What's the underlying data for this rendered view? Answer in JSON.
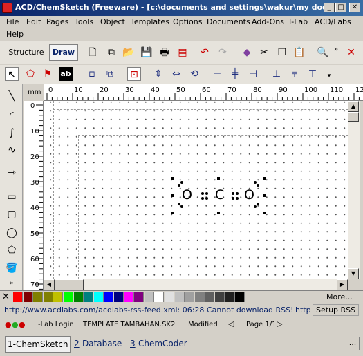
{
  "window": {
    "title": "ACD/ChemSketch (Freeware) - [c:\\documents and settings\\wakur\\my docu...",
    "min_glyph": "_",
    "max_glyph": "□",
    "close_glyph": "✕"
  },
  "menu": {
    "row1": [
      "File",
      "Edit",
      "Pages",
      "Tools",
      "Object",
      "Templates",
      "Options",
      "Documents",
      "Add-Ons",
      "I-Lab",
      "ACD/Labs"
    ],
    "row2": [
      "Help"
    ]
  },
  "modes": {
    "structure": "Structure",
    "draw": "Draw",
    "active": "Draw"
  },
  "toolbar1_icons": [
    "new-page-icon",
    "copy-page-icon",
    "open-folder-icon",
    "save-icon",
    "print-icon",
    "pdf-icon",
    "undo-icon",
    "redo-icon",
    "eraser-icon",
    "cut-icon",
    "copy-icon",
    "paste-icon",
    "zoom-icon"
  ],
  "toolbar2_icons": [
    "select-arrow-icon",
    "lasso-icon",
    "hand-icon",
    "text-icon",
    "group-icon",
    "ungroup-icon",
    "select-rect-icon",
    "flip-vertical-icon",
    "flip-horizontal-icon",
    "rotate-icon",
    "align-left-icon",
    "align-center-icon",
    "align-right-icon",
    "align-bottom-icon",
    "align-middle-icon",
    "align-top-icon"
  ],
  "left_tools": [
    "line-icon",
    "arc-icon",
    "bezier-icon",
    "curve-icon",
    "arrow-icon",
    "rectangle-icon",
    "rounded-rectangle-icon",
    "ellipse-icon",
    "polygon-icon",
    "fill-icon"
  ],
  "ruler": {
    "unit": "mm",
    "h_ticks": [
      "0",
      "10",
      "20",
      "30",
      "40",
      "50",
      "60",
      "70",
      "80",
      "90",
      "100",
      "110",
      "12"
    ],
    "v_ticks": [
      "0",
      "10",
      "20",
      "30",
      "40",
      "50",
      "60",
      "70"
    ]
  },
  "molecule": {
    "left": "O",
    "center": "C",
    "right": "O",
    "dot_glyph": "•"
  },
  "palette": {
    "colors": [
      "#ff0000",
      "#800000",
      "#808000",
      "#808000",
      "#c0c000",
      "#00ff00",
      "#008000",
      "#008080",
      "#00ffff",
      "#0000ff",
      "#000080",
      "#ff00ff",
      "#800080",
      "#c0c0c0",
      "#ffffff",
      "#e0e0e0",
      "#c0c0c0",
      "#a0a0a0",
      "#808080",
      "#606060",
      "#404040",
      "#202020",
      "#000000"
    ],
    "more_label": "More..."
  },
  "rss": {
    "text": "http://www.acdlabs.com/acdlabs-rss-feed.xml: 06:28 Cannot download RSS!",
    "short_link": "http",
    "setup": "Setup RSS"
  },
  "status": {
    "ilab": "I-Lab Login",
    "file": "TEMPLATE TAMBAHAN.SK2",
    "modified": "Modified",
    "page": "Page 1/1"
  },
  "tabs": [
    {
      "num": "1",
      "label": "-ChemSketch"
    },
    {
      "num": "2",
      "label": "-Database"
    },
    {
      "num": "3",
      "label": "-ChemCoder"
    }
  ],
  "tabs_more": "..."
}
